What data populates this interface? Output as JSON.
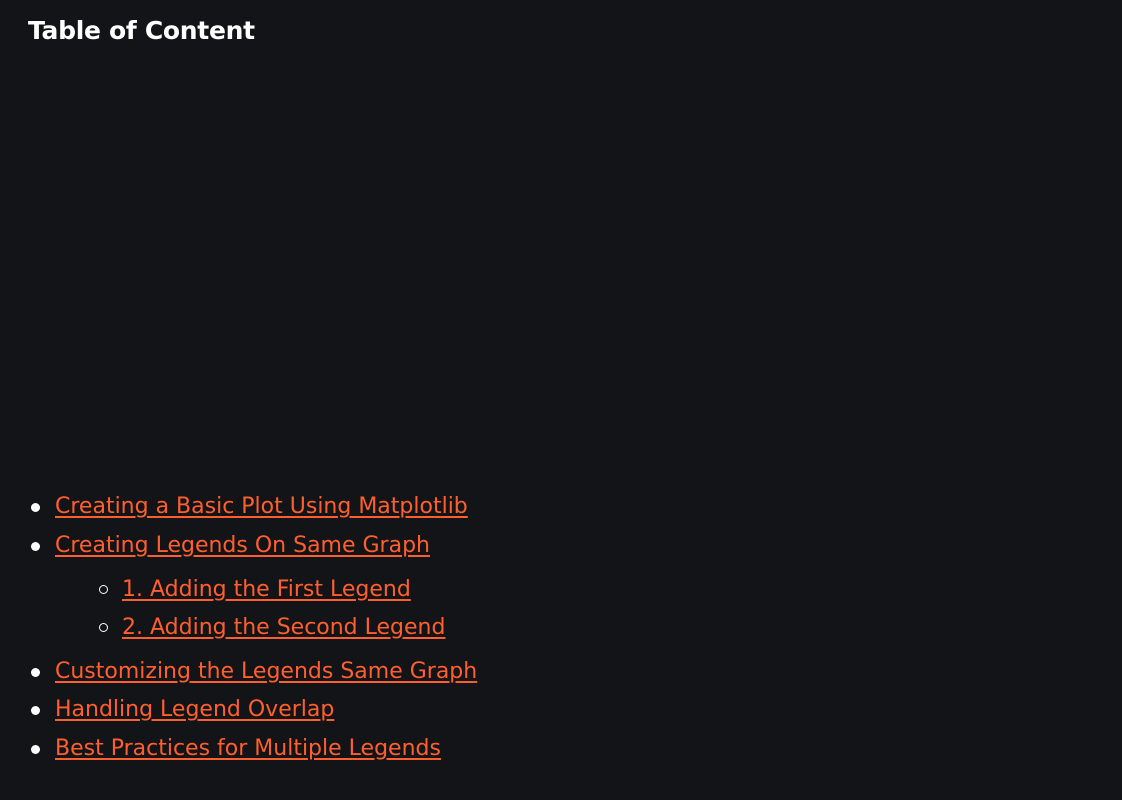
{
  "toc": {
    "title": "Table of Content",
    "items": [
      {
        "label": "Creating a Basic Plot Using Matplotlib"
      },
      {
        "label": "Creating Legends On Same Graph",
        "children": [
          {
            "label": "1. Adding the First Legend"
          },
          {
            "label": "2. Adding the Second Legend"
          }
        ]
      },
      {
        "label": "Customizing the Legends Same Graph"
      },
      {
        "label": "Handling Legend Overlap"
      },
      {
        "label": "Best Practices for Multiple Legends"
      }
    ]
  },
  "colors": {
    "background": "#131417",
    "link": "#ff5f2e",
    "text": "#ffffff"
  }
}
